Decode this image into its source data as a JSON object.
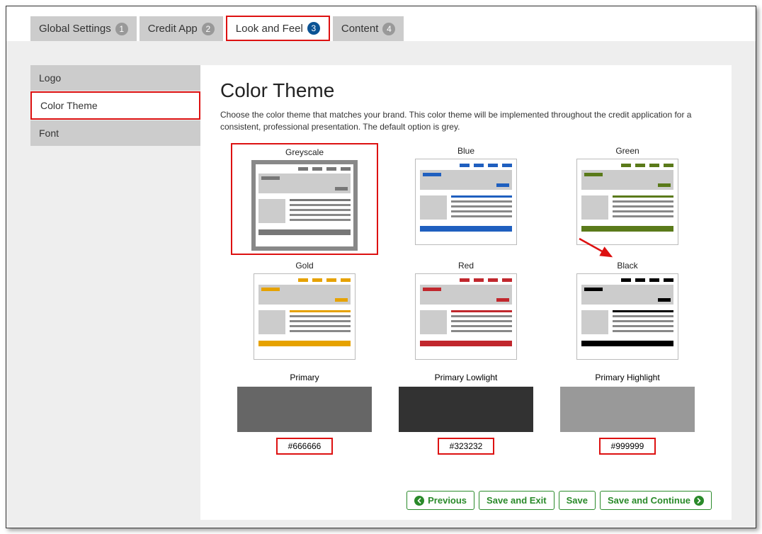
{
  "tabs": [
    {
      "label": "Global Settings",
      "num": "1"
    },
    {
      "label": "Credit App",
      "num": "2"
    },
    {
      "label": "Look and Feel",
      "num": "3"
    },
    {
      "label": "Content",
      "num": "4"
    }
  ],
  "sidebar": [
    {
      "label": "Logo"
    },
    {
      "label": "Color Theme"
    },
    {
      "label": "Font"
    }
  ],
  "page": {
    "title": "Color Theme",
    "desc": "Choose the color theme that matches your brand. This color theme will be implemented throughout the credit application for a consistent, professional presentation. The default option is grey."
  },
  "themes": [
    {
      "label": "Greyscale",
      "color": "#777777",
      "selected": true
    },
    {
      "label": "Blue",
      "color": "#1f5fbf"
    },
    {
      "label": "Green",
      "color": "#5a7a1a"
    },
    {
      "label": "Gold",
      "color": "#e6a200"
    },
    {
      "label": "Red",
      "color": "#c1272d"
    },
    {
      "label": "Black",
      "color": "#000000"
    }
  ],
  "swatches": [
    {
      "label": "Primary",
      "color": "#666666",
      "hex": "#666666"
    },
    {
      "label": "Primary Lowlight",
      "color": "#323232",
      "hex": "#323232"
    },
    {
      "label": "Primary Highlight",
      "color": "#999999",
      "hex": "#999999"
    }
  ],
  "buttons": {
    "previous": "Previous",
    "saveExit": "Save and Exit",
    "save": "Save",
    "saveContinue": "Save and Continue"
  }
}
